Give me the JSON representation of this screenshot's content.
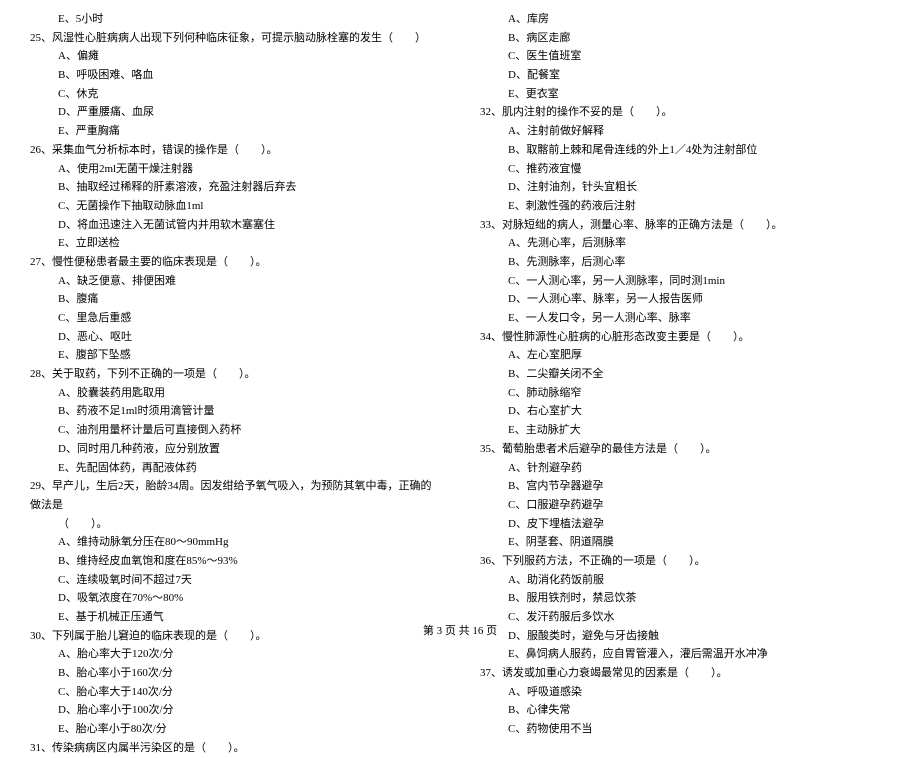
{
  "leftColumn": {
    "q24_optE": "E、5小时",
    "q25": "25、风湿性心脏病病人出现下列何种临床征象，可提示脑动脉栓塞的发生（　　）",
    "q25_A": "A、偏瘫",
    "q25_B": "B、呼吸困难、咯血",
    "q25_C": "C、休克",
    "q25_D": "D、严重腰痛、血尿",
    "q25_E": "E、严重胸痛",
    "q26": "26、采集血气分析标本时，错误的操作是（　　）。",
    "q26_A": "A、使用2ml无菌干燥注射器",
    "q26_B": "B、抽取经过稀释的肝素溶液，充盈注射器后弃去",
    "q26_C": "C、无菌操作下抽取动脉血1ml",
    "q26_D": "D、将血迅速注入无菌试管内并用软木塞塞住",
    "q26_E": "E、立即送检",
    "q27": "27、慢性便秘患者最主要的临床表现是（　　）。",
    "q27_A": "A、缺乏便意、排便困难",
    "q27_B": "B、腹痛",
    "q27_C": "C、里急后重感",
    "q27_D": "D、恶心、呕吐",
    "q27_E": "E、腹部下坠感",
    "q28": "28、关于取药，下列不正确的一项是（　　）。",
    "q28_A": "A、胶囊装药用匙取用",
    "q28_B": "B、药液不足1ml时须用滴管计量",
    "q28_C": "C、油剂用量杯计量后可直接倒入药杯",
    "q28_D": "D、同时用几种药液，应分别放置",
    "q28_E": "E、先配固体药，再配液体药",
    "q29": "29、早产儿，生后2天，胎龄34周。因发绀给予氧气吸入，为预防其氧中毒，正确的做法是",
    "q29_cont": "（　　）。",
    "q29_A": "A、维持动脉氧分压在80～90mmHg",
    "q29_B": "B、维持经皮血氧饱和度在85%～93%",
    "q29_C": "C、连续吸氧时间不超过7天",
    "q29_D": "D、吸氧浓度在70%～80%",
    "q29_E": "E、基于机械正压通气",
    "q30": "30、下列属于胎儿窘迫的临床表现的是（　　）。",
    "q30_A": "A、胎心率大于120次/分",
    "q30_B": "B、胎心率小于160次/分",
    "q30_C": "C、胎心率大于140次/分",
    "q30_D": "D、胎心率小于100次/分",
    "q30_E": "E、胎心率小于80次/分",
    "q31": "31、传染病病区内属半污染区的是（　　）。"
  },
  "rightColumn": {
    "q31_A": "A、库房",
    "q31_B": "B、病区走廊",
    "q31_C": "C、医生值班室",
    "q31_D": "D、配餐室",
    "q31_E": "E、更衣室",
    "q32": "32、肌内注射的操作不妥的是（　　）。",
    "q32_A": "A、注射前做好解释",
    "q32_B": "B、取髂前上棘和尾骨连线的外上1／4处为注射部位",
    "q32_C": "C、推药液宜慢",
    "q32_D": "D、注射油剂，针头宜粗长",
    "q32_E": "E、刺激性强的药液后注射",
    "q33": "33、对脉短绌的病人，测量心率、脉率的正确方法是（　　）。",
    "q33_A": "A、先测心率，后测脉率",
    "q33_B": "B、先测脉率，后测心率",
    "q33_C": "C、一人测心率，另一人测脉率，同时测1min",
    "q33_D": "D、一人测心率、脉率，另一人报告医师",
    "q33_E": "E、一人发口令，另一人测心率、脉率",
    "q34": "34、慢性肺源性心脏病的心脏形态改变主要是（　　）。",
    "q34_A": "A、左心室肥厚",
    "q34_B": "B、二尖瓣关闭不全",
    "q34_C": "C、肺动脉缩窄",
    "q34_D": "D、右心室扩大",
    "q34_E": "E、主动脉扩大",
    "q35": "35、葡萄胎患者术后避孕的最佳方法是（　　）。",
    "q35_A": "A、针剂避孕药",
    "q35_B": "B、宫内节孕器避孕",
    "q35_C": "C、口服避孕药避孕",
    "q35_D": "D、皮下埋植法避孕",
    "q35_E": "E、阴茎套、阴道隔膜",
    "q36": "36、下列服药方法，不正确的一项是（　　）。",
    "q36_A": "A、助消化药饭前服",
    "q36_B": "B、服用铁剂时，禁忌饮茶",
    "q36_C": "C、发汗药服后多饮水",
    "q36_D": "D、服酸类时，避免与牙齿接触",
    "q36_E": "E、鼻饲病人服药，应自胃管灌入，灌后需温开水冲净",
    "q37": "37、诱发或加重心力衰竭最常见的因素是（　　）。",
    "q37_A": "A、呼吸道感染",
    "q37_B": "B、心律失常",
    "q37_C": "C、药物使用不当"
  },
  "footer": "第 3 页 共 16 页"
}
